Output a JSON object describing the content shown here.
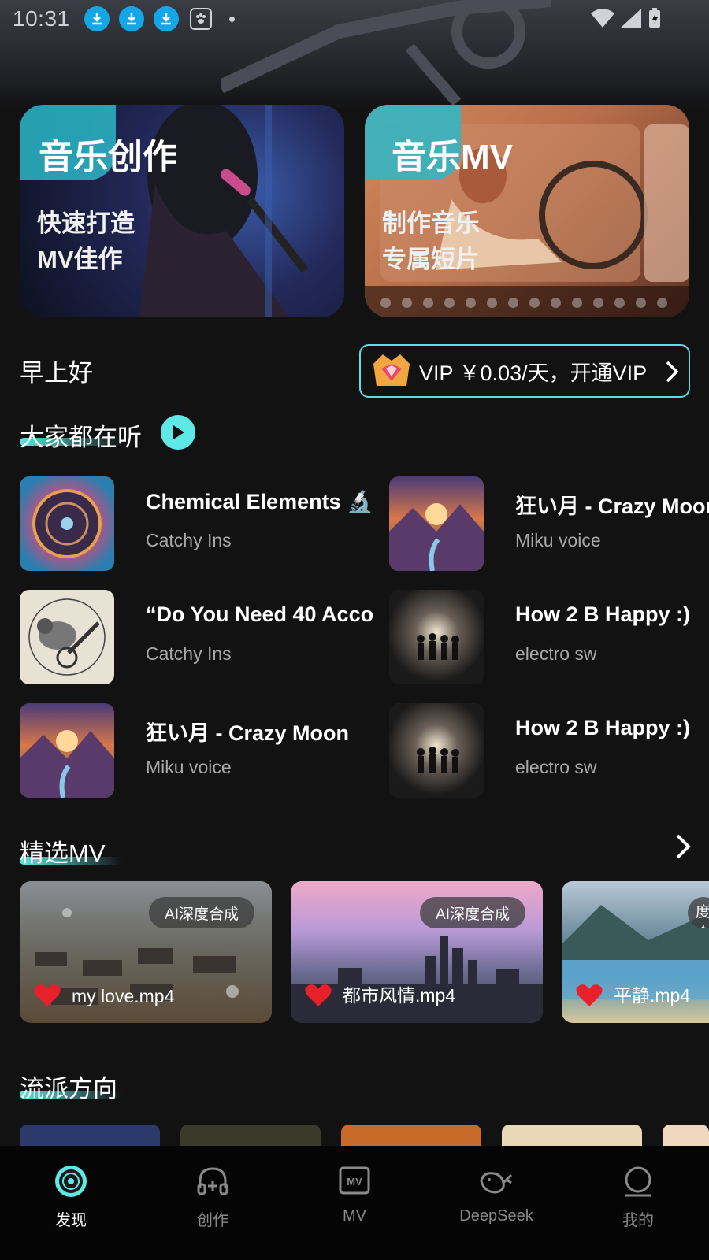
{
  "status_bar": {
    "time": "10:31"
  },
  "banners": [
    {
      "title": "音乐创作",
      "subtitle_line1": "快速打造",
      "subtitle_line2": "MV佳作"
    },
    {
      "title": "音乐MV",
      "subtitle_line1": "制作音乐",
      "subtitle_line2": "专属短片"
    }
  ],
  "greeting": "早上好",
  "vip": {
    "label": "VIP ￥0.03/天，开通VIP"
  },
  "popular": {
    "title": "大家都在听",
    "songs": [
      {
        "title": "Chemical Elements 🔬",
        "artist": "Catchy Ins"
      },
      {
        "title": "狂い月 - Crazy Moon",
        "artist": "Miku voice"
      },
      {
        "title": "“Do You Need 40 Acco",
        "artist": "Catchy Ins"
      },
      {
        "title": "How 2 B Happy :)",
        "artist": "electro sw"
      },
      {
        "title": "狂い月 - Crazy Moon",
        "artist": "Miku voice"
      },
      {
        "title": "How 2 B Happy :)",
        "artist": "electro sw"
      }
    ]
  },
  "featured_mv": {
    "title": "精选MV",
    "items": [
      {
        "badge": "AI深度合成",
        "name": "my love.mp4"
      },
      {
        "badge": "AI深度合成",
        "name": "都市风情.mp4"
      },
      {
        "badge": "AI深度合成",
        "name": "平静.mp4"
      }
    ]
  },
  "genres": {
    "title": "流派方向"
  },
  "nav": [
    {
      "label": "发现",
      "icon": "disc-icon",
      "active": true
    },
    {
      "label": "创作",
      "icon": "headphones-icon",
      "active": false
    },
    {
      "label": "MV",
      "icon": "mv-icon",
      "active": false
    },
    {
      "label": "DeepSeek",
      "icon": "whale-icon",
      "active": false
    },
    {
      "label": "我的",
      "icon": "profile-icon",
      "active": false
    }
  ],
  "colors": {
    "accent": "#5fe9e6",
    "background": "#121212",
    "heart": "#e8202a"
  }
}
